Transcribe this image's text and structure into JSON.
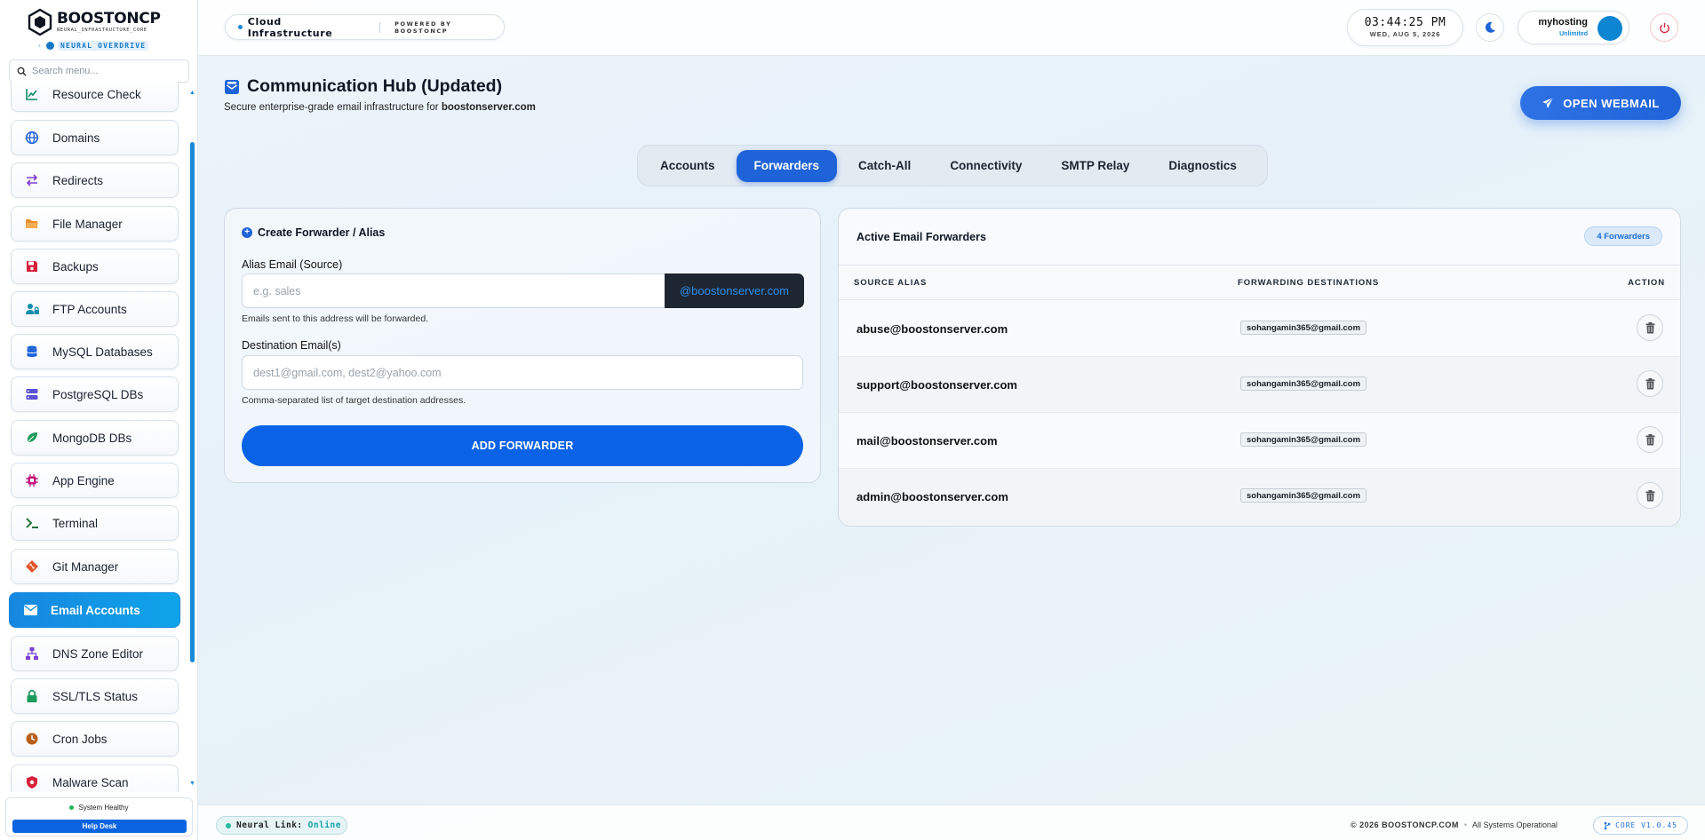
{
  "brand": {
    "name": "BOOSTONCP",
    "tagline": "NEURAL_INFRASTRUCTURE_CORE",
    "badge": "NEURAL OVERDRIVE"
  },
  "search": {
    "placeholder": "Search menu..."
  },
  "sidebar": {
    "items": [
      {
        "label": "Resource Check",
        "icon": "chart-line-icon",
        "color": "#0f8a6a"
      },
      {
        "label": "Domains",
        "icon": "globe-icon",
        "color": "#1f63d8"
      },
      {
        "label": "Redirects",
        "icon": "arrows-swap-icon",
        "color": "#7b3fd1"
      },
      {
        "label": "File Manager",
        "icon": "folder-icon",
        "color": "#e7912c"
      },
      {
        "label": "Backups",
        "icon": "floppy-disk-icon",
        "color": "#d6203b"
      },
      {
        "label": "FTP Accounts",
        "icon": "user-lock-icon",
        "color": "#0f8eaa"
      },
      {
        "label": "MySQL Databases",
        "icon": "database-icon",
        "color": "#1f63d8"
      },
      {
        "label": "PostgreSQL DBs",
        "icon": "server-icon",
        "color": "#5b4fd6"
      },
      {
        "label": "MongoDB DBs",
        "icon": "leaf-icon",
        "color": "#1b9c5a"
      },
      {
        "label": "App Engine",
        "icon": "chip-icon",
        "color": "#c2187a"
      },
      {
        "label": "Terminal",
        "icon": "terminal-icon",
        "color": "#1a6a2c"
      },
      {
        "label": "Git Manager",
        "icon": "git-diamond-icon",
        "color": "#e0572b"
      },
      {
        "label": "Email Accounts",
        "icon": "envelope-icon",
        "color": "#ffffff",
        "active": true
      },
      {
        "label": "DNS Zone Editor",
        "icon": "network-icon",
        "color": "#7b3fd1"
      },
      {
        "label": "SSL/TLS Status",
        "icon": "lock-icon",
        "color": "#1b9c5a"
      },
      {
        "label": "Cron Jobs",
        "icon": "clock-icon",
        "color": "#b75f1a"
      },
      {
        "label": "Malware Scan",
        "icon": "shield-virus-icon",
        "color": "#d6203b"
      }
    ]
  },
  "status": {
    "health": "System Healthy",
    "help": "Help Desk"
  },
  "topbar": {
    "breadcrumb": "Cloud Infrastructure",
    "powered": "POWERED BY BOOSTONCP",
    "time": "03:44:25 PM",
    "date": "WED, AUG 5, 2026",
    "user_name": "myhosting",
    "user_plan": "Unlimited"
  },
  "page": {
    "title": "Communication Hub (Updated)",
    "subtitle_prefix": "Secure enterprise-grade email infrastructure for",
    "domain": "boostonserver.com",
    "webmail_button": "OPEN WEBMAIL"
  },
  "tabs": [
    {
      "label": "Accounts"
    },
    {
      "label": "Forwarders",
      "active": true
    },
    {
      "label": "Catch-All"
    },
    {
      "label": "Connectivity"
    },
    {
      "label": "SMTP Relay"
    },
    {
      "label": "Diagnostics"
    }
  ],
  "create_form": {
    "heading": "Create Forwarder / Alias",
    "alias_label": "Alias Email (Source)",
    "alias_placeholder": "e.g. sales",
    "alias_suffix": "@boostonserver.com",
    "alias_hint": "Emails sent to this address will be forwarded.",
    "dest_label": "Destination Email(s)",
    "dest_placeholder": "dest1@gmail.com, dest2@yahoo.com",
    "dest_hint": "Comma-separated list of target destination addresses.",
    "submit": "ADD FORWARDER"
  },
  "forwarders": {
    "title": "Active Email Forwarders",
    "count_badge": "4 Forwarders",
    "columns": [
      "SOURCE ALIAS",
      "FORWARDING DESTINATIONS",
      "ACTION"
    ],
    "rows": [
      {
        "alias": "abuse@boostonserver.com",
        "destination": "sohangamin365@gmail.com"
      },
      {
        "alias": "support@boostonserver.com",
        "destination": "sohangamin365@gmail.com"
      },
      {
        "alias": "mail@boostonserver.com",
        "destination": "sohangamin365@gmail.com"
      },
      {
        "alias": "admin@boostonserver.com",
        "destination": "sohangamin365@gmail.com"
      }
    ]
  },
  "footer": {
    "neural_label": "Neural Link:",
    "neural_state": "Online",
    "copyright": "© 2026 BOOSTONCP.COM",
    "operational": "All Systems Operational",
    "version": "CORE V1.0.45"
  }
}
